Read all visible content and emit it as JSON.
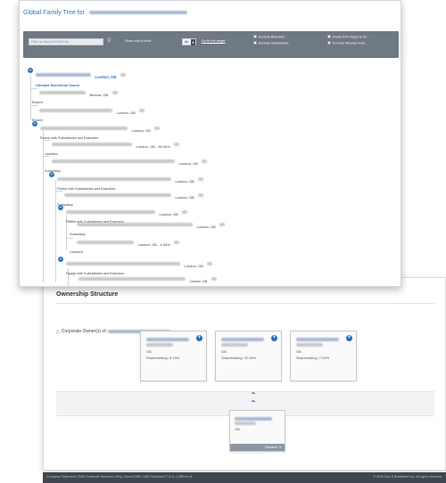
{
  "family_tree": {
    "title": "Global Family Tree for",
    "search": {
      "placeholder": "Filter by Name/DUNS/City"
    },
    "show_level_label": "Show only to level:",
    "level_value": "All",
    "goto_target_label": "Go to the target",
    "checkboxes": {
      "exclude_branches": "Exclude Branches",
      "exclude_subsidiaries": "Exclude Subsidiaries",
      "route_target": "Route from Target to Gl...",
      "exclude_minority": "Exclude Minority Holdi..."
    },
    "nodes": [
      {
        "location": "London, GB",
        "role": "Ultimate Beneficial Owner"
      },
      {
        "location": "Brecha, GB",
        "role": "Branch"
      },
      {
        "location": "London, GB",
        "role": "Branch"
      },
      {
        "location": "London, GB",
        "role": "Parent with Subsidiaries and Branches"
      },
      {
        "location": "London, GB - 50.00%",
        "role": "Unlinked"
      },
      {
        "location": "London, GB",
        "role": "Subsidiary"
      },
      {
        "location": "London, GB",
        "role": "Parent with Subsidiaries and Branches"
      },
      {
        "location": "London, GB",
        "role": "Subsidiary"
      },
      {
        "location": "London, GB",
        "role": "Parent with Subsidiaries and Branches"
      },
      {
        "location": "London, GB",
        "role": "Subsidiary"
      },
      {
        "location": "London, GB - 4.54%",
        "role": "Unlinked"
      },
      {
        "location": "London, GB",
        "role": "Parent with Subsidiaries and Branches"
      },
      {
        "location": "Oxford, GB",
        "role": "Branch"
      }
    ]
  },
  "ownership": {
    "title": "Ownership Structure",
    "corporate_owners_label": "Corporate Owner(s) of:",
    "owners": [
      {
        "country": "GB",
        "shareholding": "Shareholding: 8.13%"
      },
      {
        "country": "GB",
        "shareholding": "Shareholding: 22.66%"
      },
      {
        "country": "GB",
        "shareholding": "Shareholding: 7.04%"
      }
    ],
    "target": {
      "country": "GB",
      "footer": "Owners: 3"
    }
  },
  "footer": {
    "left": "Company Statement  |  D&B Customer Services  |  Help  |  About D&B  |  D&B Solutions  |  F.A.Q.  |  DBEnd v4",
    "right": "© 2020 Dun & Bradstreet Inc. All rights reserved."
  },
  "colors": {
    "accent": "#2e77c9",
    "toolbar": "#6f7983",
    "footer": "#3f4650"
  }
}
